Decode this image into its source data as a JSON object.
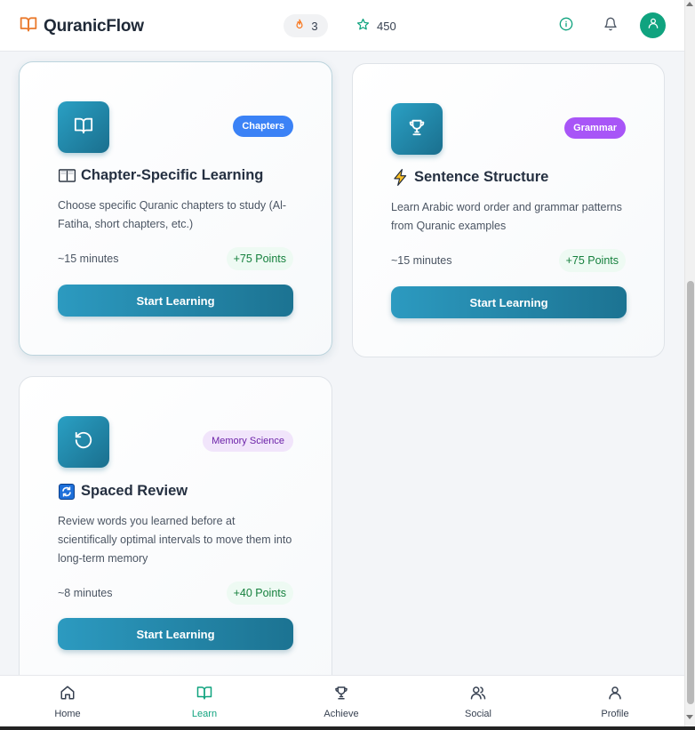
{
  "app": {
    "name": "QuranicFlow"
  },
  "header": {
    "streak": "3",
    "points": "450"
  },
  "cards": [
    {
      "icon": "book-open-icon",
      "badge": "Chapters",
      "emoji": "open-book-emoji",
      "title": "Chapter-Specific Learning",
      "description": "Choose specific Quranic chapters to study (Al-Fatiha, short chapters, etc.)",
      "time": "~15 minutes",
      "points": "+75 Points",
      "button": "Start Learning"
    },
    {
      "icon": "trophy-icon",
      "badge": "Grammar",
      "emoji": "lightning-emoji",
      "title": "Sentence Structure",
      "description": "Learn Arabic word order and grammar patterns from Quranic examples",
      "time": "~15 minutes",
      "points": "+75 Points",
      "button": "Start Learning"
    },
    {
      "icon": "rotate-icon",
      "badge": "Memory Science",
      "emoji": "refresh-emoji",
      "title": "Spaced Review",
      "description": "Review words you learned before at scientifically optimal intervals to move them into long-term memory",
      "time": "~8 minutes",
      "points": "+40 Points",
      "button": "Start Learning"
    }
  ],
  "nav": {
    "items": [
      {
        "label": "Home",
        "icon": "home-icon"
      },
      {
        "label": "Learn",
        "icon": "book-icon",
        "active": true
      },
      {
        "label": "Achieve",
        "icon": "trophy-icon"
      },
      {
        "label": "Social",
        "icon": "users-icon"
      },
      {
        "label": "Profile",
        "icon": "user-icon"
      }
    ]
  },
  "colors": {
    "accent": "#10a37f",
    "primary": "#1f86ad",
    "badge_blue": "#3b82f6",
    "badge_purple": "#a855f7"
  }
}
